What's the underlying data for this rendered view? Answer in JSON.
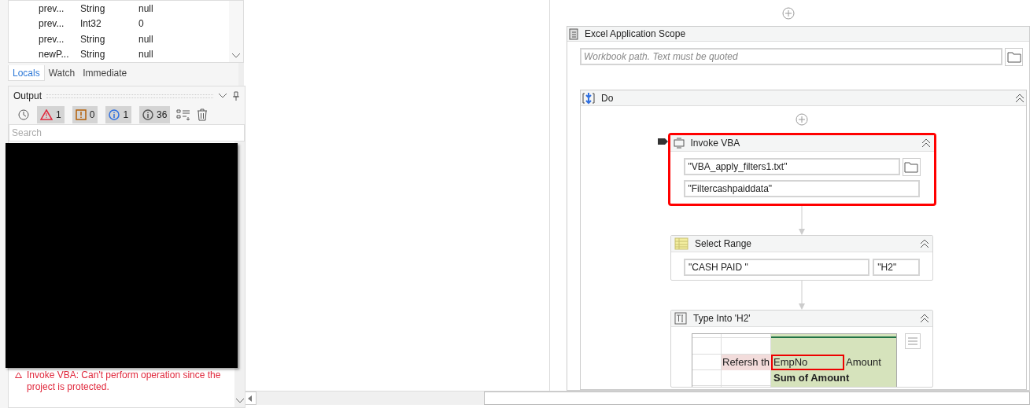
{
  "locals": {
    "rows": [
      {
        "name": "prev...",
        "type": "String",
        "value": "null"
      },
      {
        "name": "prev...",
        "type": "Int32",
        "value": "0"
      },
      {
        "name": "prev...",
        "type": "String",
        "value": "null"
      },
      {
        "name": "newP...",
        "type": "String",
        "value": "null"
      }
    ],
    "tabs": [
      {
        "label": "Locals",
        "selected": true
      },
      {
        "label": "Watch",
        "selected": false
      },
      {
        "label": "Immediate",
        "selected": false
      }
    ]
  },
  "output": {
    "title": "Output",
    "filters": [
      {
        "kind": "warning",
        "count": "1"
      },
      {
        "kind": "error",
        "count": "0"
      },
      {
        "kind": "info",
        "count": "1"
      },
      {
        "kind": "trace",
        "count": "36"
      }
    ],
    "search": {
      "placeholder": "Search"
    },
    "messages": [
      {
        "kind": "warning",
        "text": "Invoke VBA: Can't perform operation since the project is protected."
      }
    ]
  },
  "designer": {
    "scope": {
      "title": "Excel Application Scope",
      "workbook": {
        "placeholder": "Workbook path. Text must be quoted"
      },
      "body": {
        "title": "Do",
        "activities": [
          {
            "kind": "invoke_vba",
            "title": "Invoke VBA",
            "selected": true,
            "fields": [
              "\"VBA_apply_filters1.txt\"",
              "\"Filtercashpaiddata\""
            ]
          },
          {
            "kind": "select_range",
            "title": "Select Range",
            "selected": false,
            "fields": [
              "\"CASH PAID \"",
              "\"H2\""
            ]
          },
          {
            "kind": "type_into",
            "title": "Type Into 'H2'",
            "selected": false,
            "preview": {
              "note": "Refersh th",
              "header": "EmpNo",
              "value": "Amount",
              "total": "Sum of Amount"
            }
          }
        ]
      }
    }
  }
}
